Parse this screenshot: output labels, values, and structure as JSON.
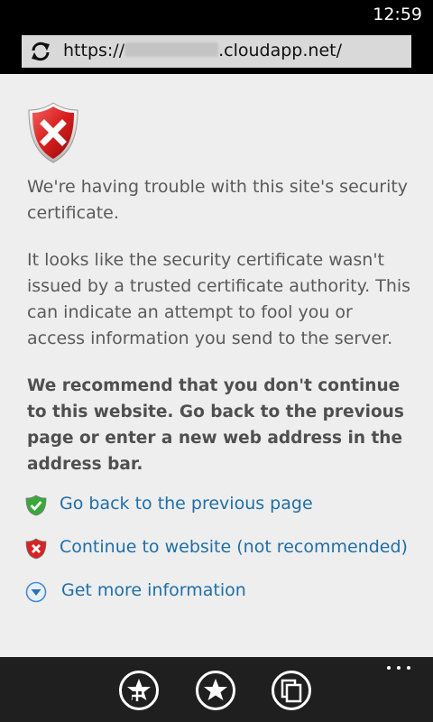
{
  "status_bar": {
    "time": "12:59"
  },
  "address_bar": {
    "url_prefix": "https://",
    "url_suffix": ".cloudapp.net/"
  },
  "warning": {
    "heading": "We're having trouble with this site's security certificate.",
    "description": "It looks like the security certificate wasn't issued by a trusted certificate authority. This can indicate an attempt to fool you or access information you send to the server.",
    "recommendation": "We recommend that you don't continue to this website. Go back to the previous page or enter a new web address in the address bar."
  },
  "links": {
    "go_back": "Go back to the previous page",
    "continue": "Continue to website (not recommended)",
    "more_info": "Get more information"
  },
  "app_bar": {
    "buttons": [
      "add-favorite",
      "favorites",
      "tabs"
    ]
  },
  "colors": {
    "background": "#eeeeee",
    "link": "#1f6fa8",
    "body_text": "#5a5a5a",
    "app_bar": "#1f1f1f"
  }
}
